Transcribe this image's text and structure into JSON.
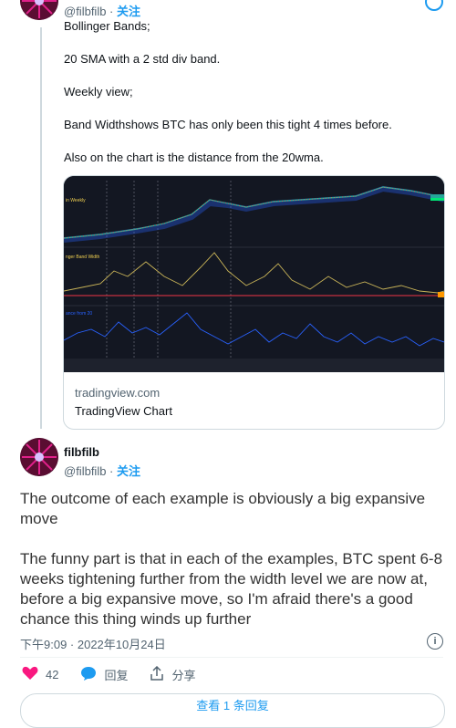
{
  "tweet1": {
    "handle": "@filbfilb",
    "follow_label": "关注",
    "paragraphs": [
      "Bollinger Bands;",
      "20 SMA with a 2 std div band.",
      "Weekly view;",
      "Band Widthshows BTC has only been this tight 4 times before.",
      "Also on the chart is the distance from the 20wma."
    ],
    "card": {
      "domain": "tradingview.com",
      "title": "TradingView Chart"
    }
  },
  "tweet2": {
    "name": "filbfilb",
    "handle": "@filbfilb",
    "follow_label": "关注",
    "paragraphs": [
      "The outcome of each example is obviously a big expansive move",
      "The funny part is that in each of the examples, BTC spent 6-8 weeks tightening further from the width level we are now at, before a big expansive move, so I'm afraid there's a good chance this thing winds up further"
    ],
    "timestamp": "下午9:09 · 2022年10月24日",
    "likes_count": "42",
    "reply_label": "回复",
    "share_label": "分享",
    "more_replies_label": "查看 1 条回复"
  },
  "icons": {
    "like": "heart-icon",
    "reply": "speech-bubble-icon",
    "share": "share-icon",
    "info": "info-icon"
  },
  "colors": {
    "accent": "#1d9bf0",
    "like": "#f91880",
    "chart_bg": "#131722"
  }
}
